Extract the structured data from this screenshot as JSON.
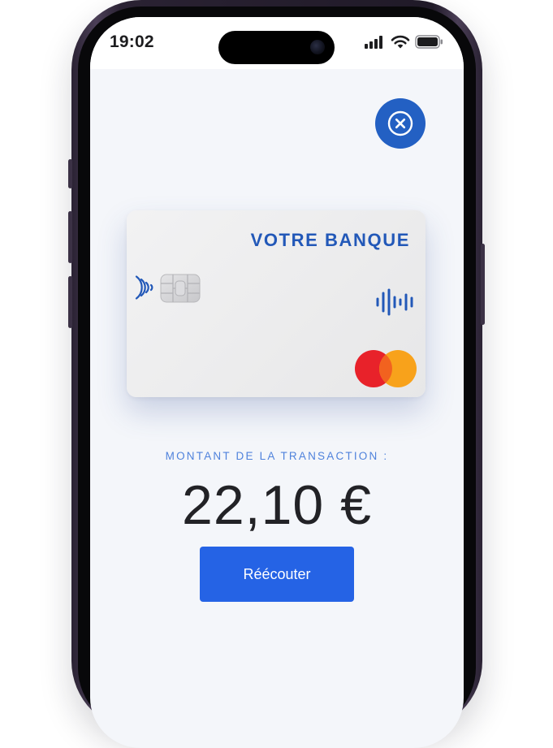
{
  "status_bar": {
    "time": "19:02",
    "icons": [
      "cellular-signal-icon",
      "wifi-icon",
      "battery-icon"
    ]
  },
  "close_button": {
    "icon": "close-icon"
  },
  "card": {
    "bank_name": "VOTRE BANQUE",
    "icons": [
      "contactless-icon",
      "chip-icon",
      "sound-wave-icon"
    ],
    "network": "mastercard",
    "colors": {
      "brand_blue": "#2258b8",
      "mc_red": "#e8222a",
      "mc_orange": "#f8a21b"
    }
  },
  "transaction": {
    "label": "MONTANT DE LA TRANSACTION :",
    "amount": "22,10 €"
  },
  "replay_button": {
    "label": "Réécouter"
  },
  "colors": {
    "accent": "#2563e5",
    "close_bg": "#2360c3",
    "label_blue": "#4f82dc",
    "screen_bg": "#f4f6fa"
  }
}
